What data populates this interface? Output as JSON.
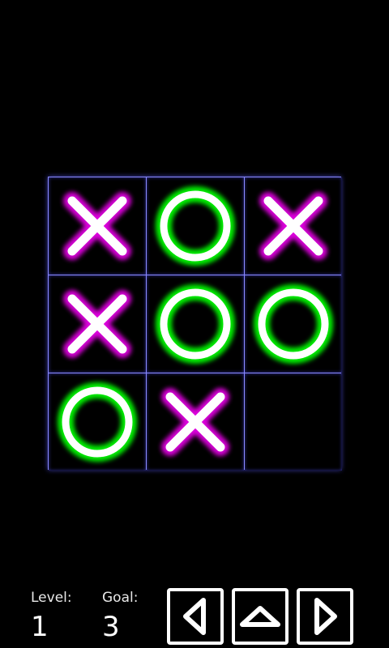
{
  "board": {
    "cells": [
      "X",
      "O",
      "X",
      "X",
      "O",
      "O",
      "O",
      "X",
      ""
    ]
  },
  "colors": {
    "x_glow": "#e000e0",
    "o_glow": "#00ee00",
    "grid": "#8a8aff"
  },
  "hud": {
    "level_label": "Level:",
    "level_value": "1",
    "goal_label": "Goal:",
    "goal_value": "3"
  },
  "controls": {
    "left_icon": "triangle-left-icon",
    "up_icon": "triangle-up-icon",
    "right_icon": "triangle-right-icon"
  }
}
